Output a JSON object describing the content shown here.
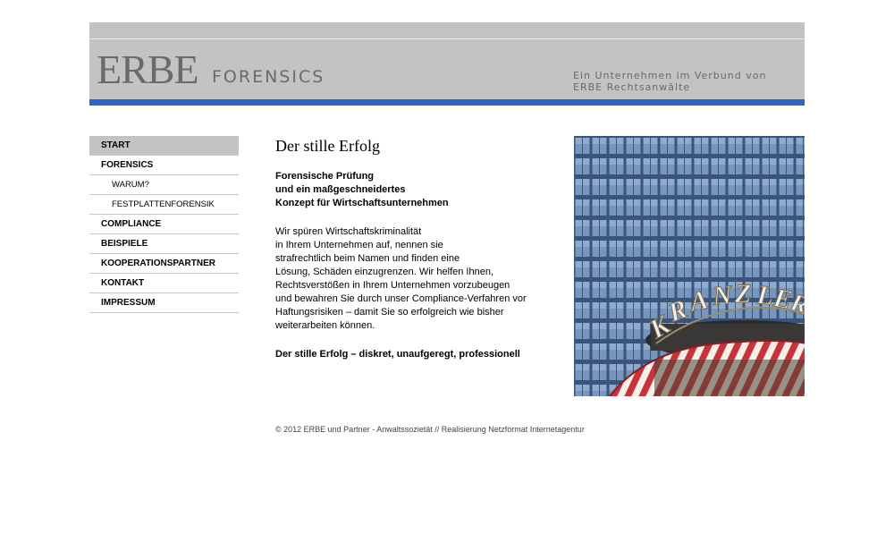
{
  "header": {
    "logo_main": "ERBE",
    "logo_sub": "FORENSICS",
    "tagline_line1": "Ein Unternehmen im Verbund von",
    "tagline_line2": "ERBE Rechtsanwälte"
  },
  "nav": {
    "items": [
      {
        "label": "START"
      },
      {
        "label": "FORENSICS"
      },
      {
        "label": "WARUM?"
      },
      {
        "label": "FESTPLATTENFORENSIK"
      },
      {
        "label": "COMPLIANCE"
      },
      {
        "label": "BEISPIELE"
      },
      {
        "label": "KOOPERATIONSPARTNER"
      },
      {
        "label": "KONTAKT"
      },
      {
        "label": "IMPRESSUM"
      }
    ]
  },
  "content": {
    "title": "Der stille Erfolg",
    "intro": [
      "Forensische Prüfung",
      "und ein maßgeschneidertes",
      "Konzept für Wirtschaftsunternehmen"
    ],
    "body": [
      "Wir spüren Wirtschaftskriminalität",
      "in Ihrem Unternehmen auf, nennen sie",
      "strafrechtlich beim Namen und finden eine",
      "Lösung, Schäden einzugrenzen. Wir helfen Ihnen,",
      "Rechtsverstößen in Ihrem Unternehmen vorzubeugen",
      "und bewahren Sie durch unser Compliance-Verfahren vor",
      "Haftungsrisiken – damit Sie so erfolgreich wie bisher",
      "weiterarbeiten können."
    ],
    "closing": "Der stille Erfolg – diskret, unaufgeregt, professionell"
  },
  "photo": {
    "sign_text": "KRANZLER"
  },
  "footer": {
    "text": "© 2012 ERBE und Partner - Anwaltssozietät // Realisierung Netzformat Internetagentur"
  },
  "colors": {
    "header_gray": "#c2c3c5",
    "accent_blue": "#2f64c8",
    "logo_gray": "#6a6a6a"
  }
}
